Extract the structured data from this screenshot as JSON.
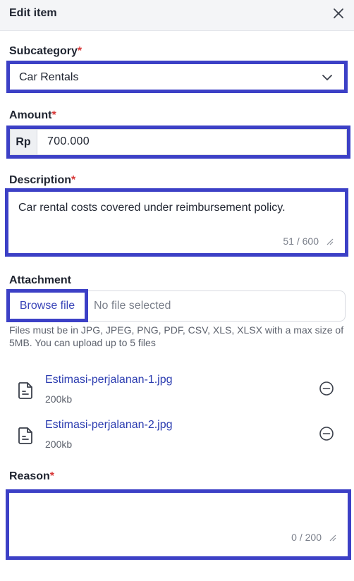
{
  "header": {
    "title": "Edit item"
  },
  "subcategory": {
    "label": "Subcategory",
    "required_mark": "*",
    "value": "Car Rentals"
  },
  "amount": {
    "label": "Amount",
    "required_mark": "*",
    "currency": "Rp",
    "value": "700.000"
  },
  "description": {
    "label": "Description",
    "required_mark": "*",
    "value": "Car rental costs covered under reimbursement policy.",
    "counter": "51 / 600"
  },
  "attachment": {
    "label": "Attachment",
    "browse_label": "Browse file",
    "no_file_text": "No file selected",
    "hint": "Files must be in JPG, JPEG, PNG, PDF, CSV, XLS, XLSX with a max size of 5MB. You can upload up to 5 files",
    "files": [
      {
        "name": "Estimasi-perjalanan-1.jpg",
        "size": "200kb"
      },
      {
        "name": "Estimasi-perjalanan-2.jpg",
        "size": "200kb"
      }
    ]
  },
  "reason": {
    "label": "Reason",
    "required_mark": "*",
    "value": "",
    "counter": "0 / 200"
  },
  "colors": {
    "accent": "#3c40c6",
    "required": "#d83a3a",
    "link": "#2b3cb0"
  }
}
